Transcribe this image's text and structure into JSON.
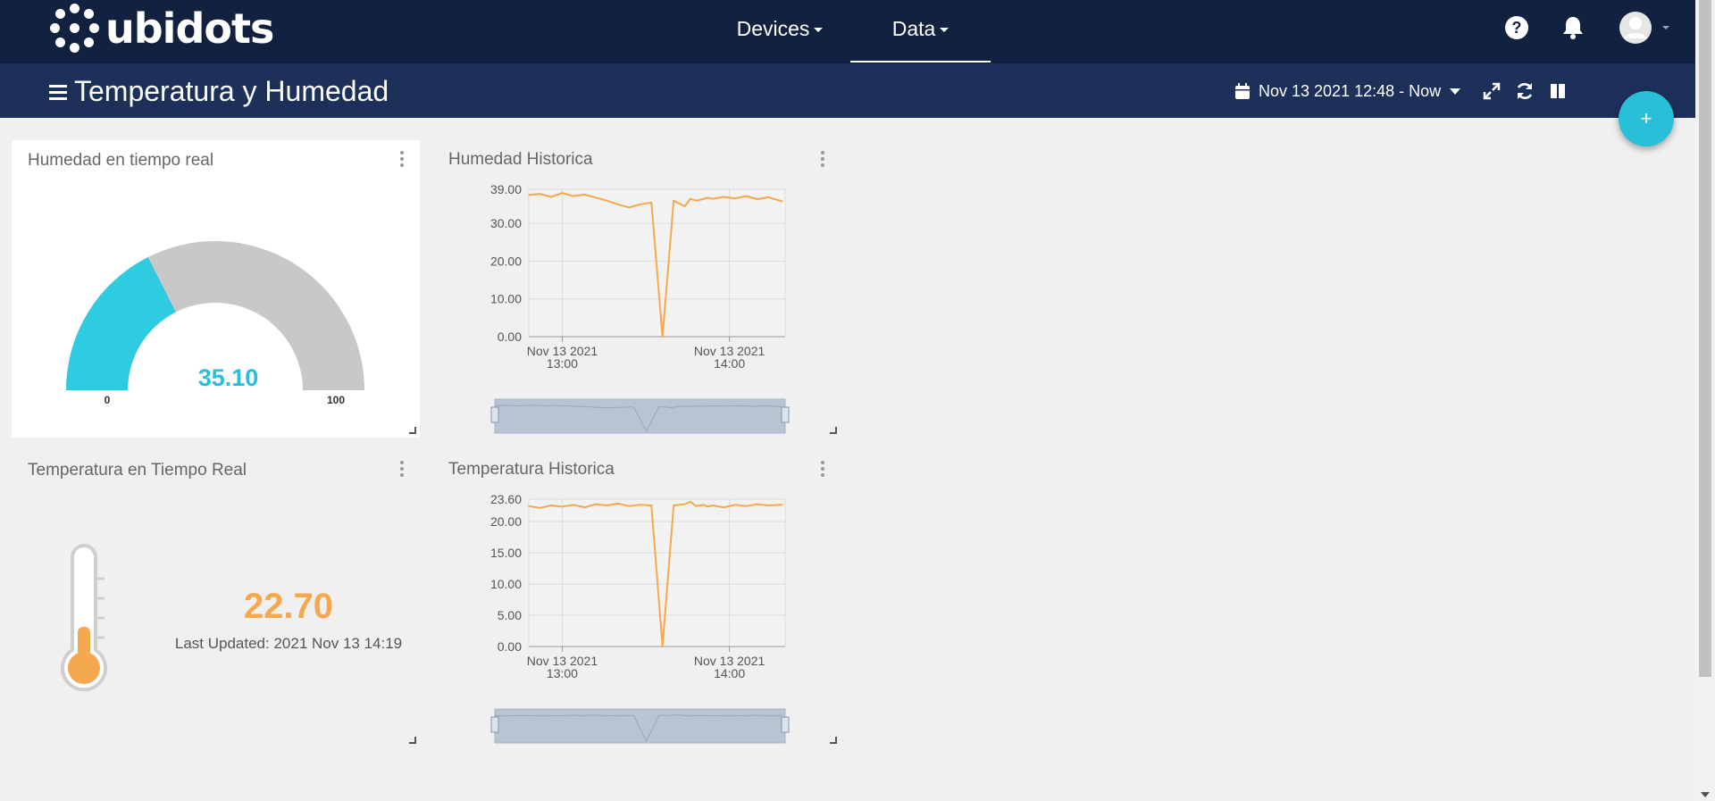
{
  "app": {
    "brand": "ubidots",
    "accent": "#27c0d8",
    "navbar_color": "#12213f",
    "dashbar_color": "#1c3059"
  },
  "nav": {
    "items": [
      {
        "label": "Devices",
        "active": false
      },
      {
        "label": "Data",
        "active": true
      }
    ],
    "icons": [
      "help-icon",
      "bell-icon",
      "user-avatar-icon"
    ]
  },
  "dashboard": {
    "title": "Temperatura y Humedad",
    "date_range": "Nov 13 2021 12:48 - Now",
    "tools": [
      "expand-icon",
      "refresh-icon",
      "columns-icon"
    ],
    "add_button": "+"
  },
  "widgets": {
    "humidity_gauge": {
      "title": "Humedad en tiempo real",
      "value": "35.10",
      "numeric_value": 35.1,
      "min_label": "0",
      "max_label": "100",
      "color": "#27c0d8"
    },
    "thermometer": {
      "title": "Temperatura en Tiempo Real",
      "value": "22.70",
      "last_updated": "Last Updated: 2021 Nov 13 14:19",
      "color": "#f5a84d"
    },
    "humidity_history": {
      "title": "Humedad Historica"
    },
    "temperature_history": {
      "title": "Temperatura Historica"
    }
  },
  "chart_data": [
    {
      "id": "humidity_history",
      "type": "line",
      "color": "#f5a84d",
      "yticks": [
        "39.00",
        "30.00",
        "20.00",
        "10.00",
        "0.00"
      ],
      "ytick_values": [
        39,
        30,
        20,
        10,
        0
      ],
      "ylim": [
        0,
        39
      ],
      "xticks": [
        [
          "Nov 13 2021",
          "13:00"
        ],
        [
          "Nov 13 2021",
          "14:00"
        ]
      ],
      "xlim": [
        "12:48",
        "14:20"
      ],
      "x": [
        "12:48",
        "12:52",
        "12:56",
        "13:00",
        "13:04",
        "13:08",
        "13:12",
        "13:16",
        "13:20",
        "13:24",
        "13:28",
        "13:32",
        "13:36",
        "13:40",
        "13:44",
        "13:46",
        "13:48",
        "13:51",
        "13:52",
        "13:54",
        "13:58",
        "14:02",
        "14:06",
        "14:10",
        "14:14",
        "14:19"
      ],
      "values": [
        37.5,
        37.8,
        37.0,
        38.0,
        37.2,
        37.6,
        36.8,
        36.0,
        35.0,
        34.2,
        35.0,
        35.5,
        0.0,
        36.0,
        34.5,
        36.5,
        36.0,
        36.5,
        36.8,
        36.5,
        37.0,
        36.6,
        37.2,
        36.4,
        36.9,
        35.8
      ]
    },
    {
      "id": "temperature_history",
      "type": "line",
      "color": "#f5a84d",
      "yticks": [
        "23.60",
        "20.00",
        "15.00",
        "10.00",
        "5.00",
        "0.00"
      ],
      "ytick_values": [
        23.6,
        20,
        15,
        10,
        5,
        0
      ],
      "ylim": [
        0,
        23.6
      ],
      "xticks": [
        [
          "Nov 13 2021",
          "13:00"
        ],
        [
          "Nov 13 2021",
          "14:00"
        ]
      ],
      "xlim": [
        "12:48",
        "14:20"
      ],
      "x": [
        "12:48",
        "12:52",
        "12:56",
        "13:00",
        "13:04",
        "13:08",
        "13:12",
        "13:16",
        "13:20",
        "13:24",
        "13:28",
        "13:32",
        "13:36",
        "13:40",
        "13:44",
        "13:46",
        "13:48",
        "13:51",
        "13:52",
        "13:54",
        "13:58",
        "14:02",
        "14:06",
        "14:10",
        "14:14",
        "14:19"
      ],
      "values": [
        22.5,
        22.2,
        22.6,
        22.4,
        22.7,
        22.3,
        22.8,
        22.6,
        22.9,
        22.5,
        22.7,
        22.6,
        0.0,
        22.6,
        22.8,
        23.2,
        22.5,
        22.7,
        22.4,
        22.6,
        22.3,
        22.7,
        22.5,
        22.8,
        22.6,
        22.7
      ]
    }
  ]
}
